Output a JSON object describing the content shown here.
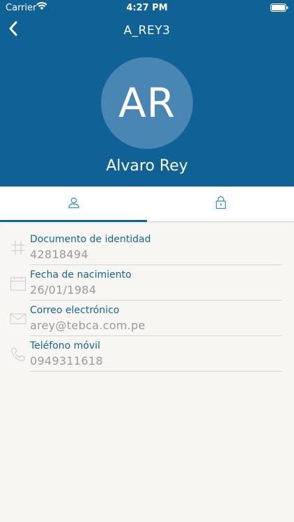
{
  "status_bar": {
    "carrier": "Carrier",
    "time": "4:27 PM"
  },
  "nav": {
    "title": "A_REY3",
    "back_icon": "chevron-left-icon"
  },
  "profile": {
    "initials": "AR",
    "name": "Alvaro Rey"
  },
  "tabs": [
    {
      "icon": "user-icon",
      "selected": true
    },
    {
      "icon": "lock-icon",
      "selected": false
    }
  ],
  "fields": [
    {
      "label": "Documento de identidad",
      "value": "42818494",
      "icon": "hash-icon"
    },
    {
      "label": "Fecha de nacimiento",
      "value": "26/01/1984",
      "icon": "calendar-icon"
    },
    {
      "label": "Correo electrónico",
      "value": "arey@tebca.com.pe",
      "icon": "mail-icon"
    },
    {
      "label": "Teléfono móvil",
      "value": "0949311618",
      "icon": "phone-icon"
    }
  ],
  "colors": {
    "header": "#0f6196",
    "avatar": "#4a86b3",
    "accent": "#17649a",
    "background": "#f7f6f3"
  }
}
